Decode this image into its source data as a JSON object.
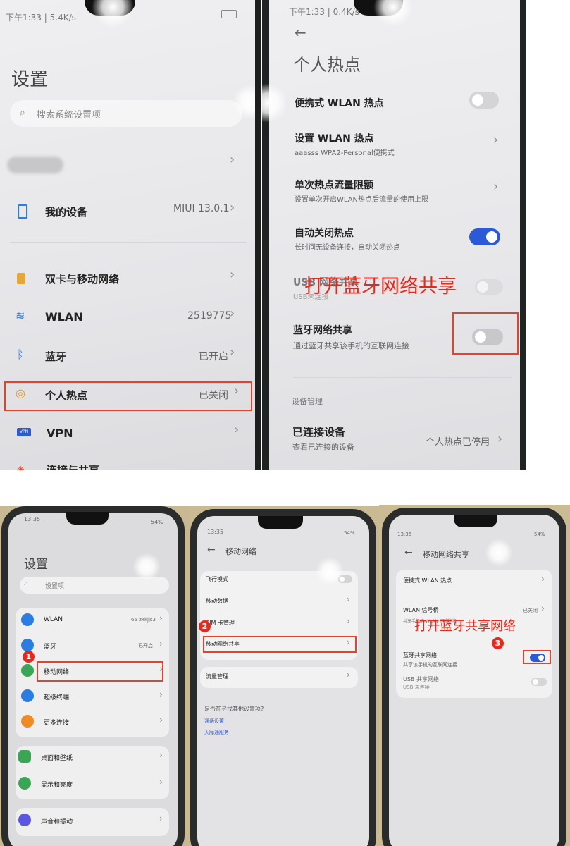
{
  "colors": {
    "annotation": "#e8281a",
    "toggle_on": "#2a5ad8",
    "toggle_off": "#c8c8c8"
  },
  "p1": {
    "status": "下午1:33 | 5.4K/s",
    "title": "设置",
    "search_placeholder": "搜索系统设置项",
    "rows": [
      {
        "label": "我的设备",
        "value": "MIUI 13.0.1",
        "icon": "phone-icon"
      },
      {
        "label": "双卡与移动网络",
        "value": "",
        "icon": "sim-icon"
      },
      {
        "label": "WLAN",
        "value": "2519775",
        "icon": "wifi-icon"
      },
      {
        "label": "蓝牙",
        "value": "已开启",
        "icon": "bluetooth-icon"
      },
      {
        "label": "个人热点",
        "value": "已关闭",
        "icon": "hotspot-icon"
      },
      {
        "label": "VPN",
        "value": "",
        "icon": "vpn-icon"
      },
      {
        "label": "连接与共享",
        "value": "",
        "icon": "share-icon"
      }
    ]
  },
  "p2": {
    "status": "下午1:33 | 0.4K/s",
    "title": "个人热点",
    "items": [
      {
        "label": "便携式 WLAN 热点",
        "sub": "",
        "control": "toggle-off"
      },
      {
        "label": "设置 WLAN 热点",
        "sub": "aaasss WPA2-Personal便携式",
        "control": "chevron"
      },
      {
        "label": "单次热点流量限额",
        "sub": "设置单次开启WLAN热点后流量的使用上限",
        "control": "chevron"
      },
      {
        "label": "自动关闭热点",
        "sub": "长时间无设备连接，自动关闭热点",
        "control": "toggle-on"
      },
      {
        "label": "USB 网络共享",
        "sub": "USB未连接",
        "control": "toggle-off"
      },
      {
        "label": "蓝牙网络共享",
        "sub": "通过蓝牙共享该手机的互联网连接",
        "control": "toggle-off"
      }
    ],
    "section": "设备管理",
    "connected": {
      "label": "已连接设备",
      "sub": "查看已连接的设备",
      "value": "个人热点已停用"
    },
    "annotation": "打开蓝牙网络共享"
  },
  "p3": {
    "status": "13:35",
    "battery": "54%",
    "title": "设置",
    "search_placeholder": "设置项",
    "rows": [
      {
        "label": "WLAN",
        "value": "65 zxkjjs3",
        "icon": "wifi-icon",
        "color": "#2a7de1"
      },
      {
        "label": "蓝牙",
        "value": "已开启",
        "icon": "bluetooth-icon",
        "color": "#2a7de1"
      },
      {
        "label": "移动网络",
        "value": "",
        "icon": "mobile-data-icon",
        "color": "#3aa655"
      },
      {
        "label": "超级终端",
        "value": "",
        "icon": "super-device-icon",
        "color": "#2a7de1"
      },
      {
        "label": "更多连接",
        "value": "",
        "icon": "link-icon",
        "color": "#f08a24"
      },
      {
        "label": "桌面和壁纸",
        "value": "",
        "icon": "wallpaper-icon",
        "color": "#3aa655"
      },
      {
        "label": "显示和亮度",
        "value": "",
        "icon": "display-icon",
        "color": "#3aa655"
      },
      {
        "label": "声音和振动",
        "value": "",
        "icon": "sound-icon",
        "color": "#5b57e0"
      }
    ],
    "badge": "1"
  },
  "p4": {
    "status": "13:35",
    "battery": "54%",
    "title": "移动网络",
    "items": [
      "飞行模式",
      "移动数据",
      "SIM 卡管理",
      "移动网络共享",
      "流量管理"
    ],
    "question": "是否在寻找其他设置项?",
    "links": [
      "通话设置",
      "天际通服务"
    ],
    "badge": "2"
  },
  "p5": {
    "status": "13:35",
    "battery": "54%",
    "title": "移动网络共享",
    "item1": "便携式 WLAN 热点",
    "item2": {
      "label": "WLAN 信号桥",
      "value": "已关闭",
      "sub": "共享手机的 WLAN 网络连接"
    },
    "item3": {
      "label": "蓝牙共享网络",
      "sub": "共享该手机的互联网连接"
    },
    "item4": {
      "label": "USB 共享网络",
      "sub": "USB 未连接"
    },
    "annotation": "打开蓝牙共享网络",
    "badge": "3"
  }
}
